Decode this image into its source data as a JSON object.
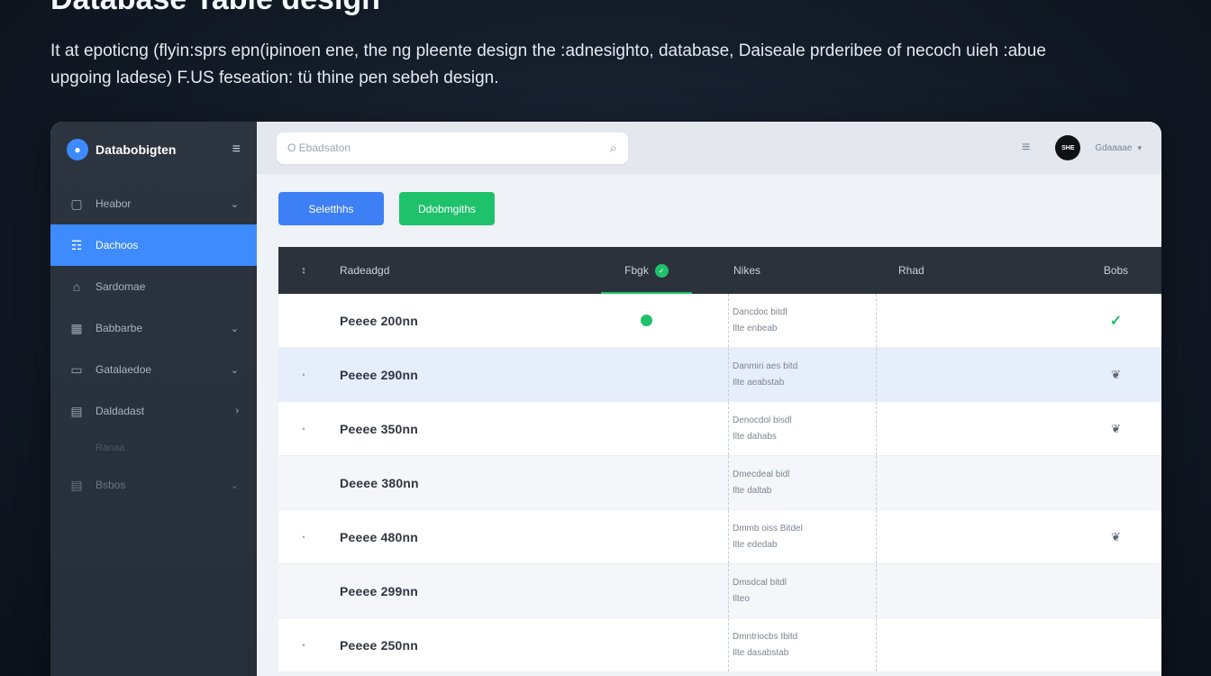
{
  "page": {
    "title": "Database Table design",
    "intro_line1": "It at epoticng (flyin:sprs epn(ipinoen ene, the ng pleente design the :adnesighto, database, Daiseale prderibee of necoch uieh :abue",
    "intro_line2": "upgoing ladese) F.US feseation: tü thine pen sebeh design."
  },
  "app": {
    "brand_name": "Databobigten",
    "brand_logo": "●",
    "brand_toggle": "≡"
  },
  "sidebar": {
    "items": [
      {
        "icon": "▢",
        "label": "Heabor",
        "chevron": "⌄"
      },
      {
        "icon": "☶",
        "label": "Dachoos",
        "chevron": ""
      },
      {
        "icon": "⌂",
        "label": "Sardomae",
        "chevron": ""
      },
      {
        "icon": "▦",
        "label": "Babbarbe",
        "chevron": "⌄"
      },
      {
        "icon": "▭",
        "label": "Gatalaedoe",
        "chevron": "⌄"
      },
      {
        "icon": "▤",
        "label": "Daldadast",
        "chevron": "›"
      },
      {
        "icon": "▤",
        "label": "Bsbos",
        "chevron": "⌄"
      }
    ],
    "sub_label": "Ranaa"
  },
  "topbar": {
    "search_placeholder": "O Ebadsaton",
    "search_icon": "⌕",
    "menu_icon": "≡",
    "avatar_text": "SHE",
    "user_name": "Gdaaaae",
    "user_chevron": "▾"
  },
  "toolbar": {
    "primary_label": "Seletthhs",
    "success_label": "Ddobmgiths"
  },
  "table": {
    "columns": {
      "sort": "↕",
      "name": "Radeadgd",
      "status": "Fbgk",
      "notes": "Nikes",
      "read": "Rhad",
      "state": "Bobs"
    },
    "status_header_check": "✓",
    "rows": [
      {
        "handle": "",
        "name": "Peeee 200nn",
        "status": true,
        "note1": "Dancdoc bitdl",
        "note2": "Ilte enbeab",
        "state": "✓",
        "state_type": "check"
      },
      {
        "handle": "•",
        "name": "Peeee 290nn",
        "status": false,
        "note1": "Danmiri aes bitd",
        "note2": "Ilte aeabstab",
        "state": "❦",
        "state_type": "link"
      },
      {
        "handle": "•",
        "name": "Peeee 350nn",
        "status": false,
        "note1": "Denocdol bisdl",
        "note2": "Ilte dahabs",
        "state": "❦",
        "state_type": "link"
      },
      {
        "handle": "",
        "name": "Deeee 380nn",
        "status": false,
        "note1": "Dmecdeal bidl",
        "note2": "Ilte daltab",
        "state": "",
        "state_type": ""
      },
      {
        "handle": "•",
        "name": "Peeee 480nn",
        "status": false,
        "note1": "Dmmb oiss Bitdel",
        "note2": "Ilte ededab",
        "state": "❦",
        "state_type": "link"
      },
      {
        "handle": "",
        "name": "Peeee 299nn",
        "status": false,
        "note1": "Dmsdcal bitdl",
        "note2": "Ilteo",
        "state": "",
        "state_type": ""
      },
      {
        "handle": "•",
        "name": "Peeee 250nn",
        "status": false,
        "note1": "Dmntriocbs Ibitd",
        "note2": "Ilte dasabstab",
        "state": "",
        "state_type": ""
      }
    ]
  },
  "colors": {
    "accent": "#3d8bfd",
    "success": "#1ec26a",
    "sidebar": "#2c3440",
    "table_header": "#2b323c"
  }
}
